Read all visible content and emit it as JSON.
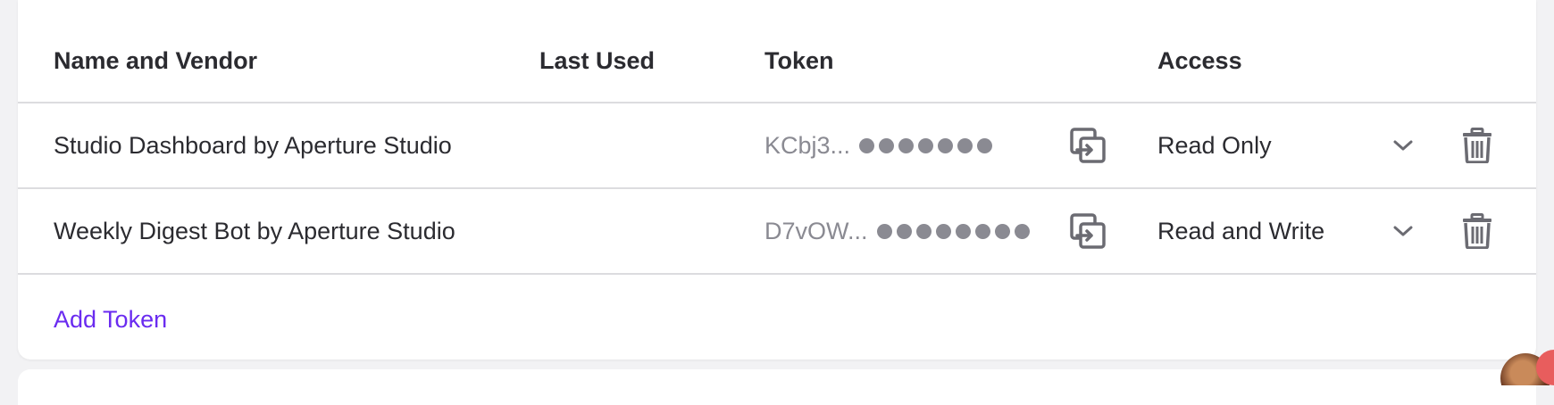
{
  "table": {
    "headers": {
      "name": "Name and Vendor",
      "last_used": "Last Used",
      "token": "Token",
      "access": "Access"
    },
    "rows": [
      {
        "name": "Studio Dashboard by Aperture Studio",
        "last_used": "",
        "token_prefix": "KCbj3...",
        "access": "Read Only"
      },
      {
        "name": "Weekly Digest Bot by Aperture Studio",
        "last_used": "",
        "token_prefix": "D7vOW...",
        "access": "Read and Write"
      }
    ]
  },
  "add_token_label": "Add Token",
  "colors": {
    "link": "#6a2bf0",
    "muted_text": "#8a8a92",
    "divider": "#dcdcdf",
    "icon": "#6b6b72"
  },
  "icons": {
    "copy": "copy-icon",
    "chevron": "chevron-down-icon",
    "delete": "trash-icon"
  }
}
